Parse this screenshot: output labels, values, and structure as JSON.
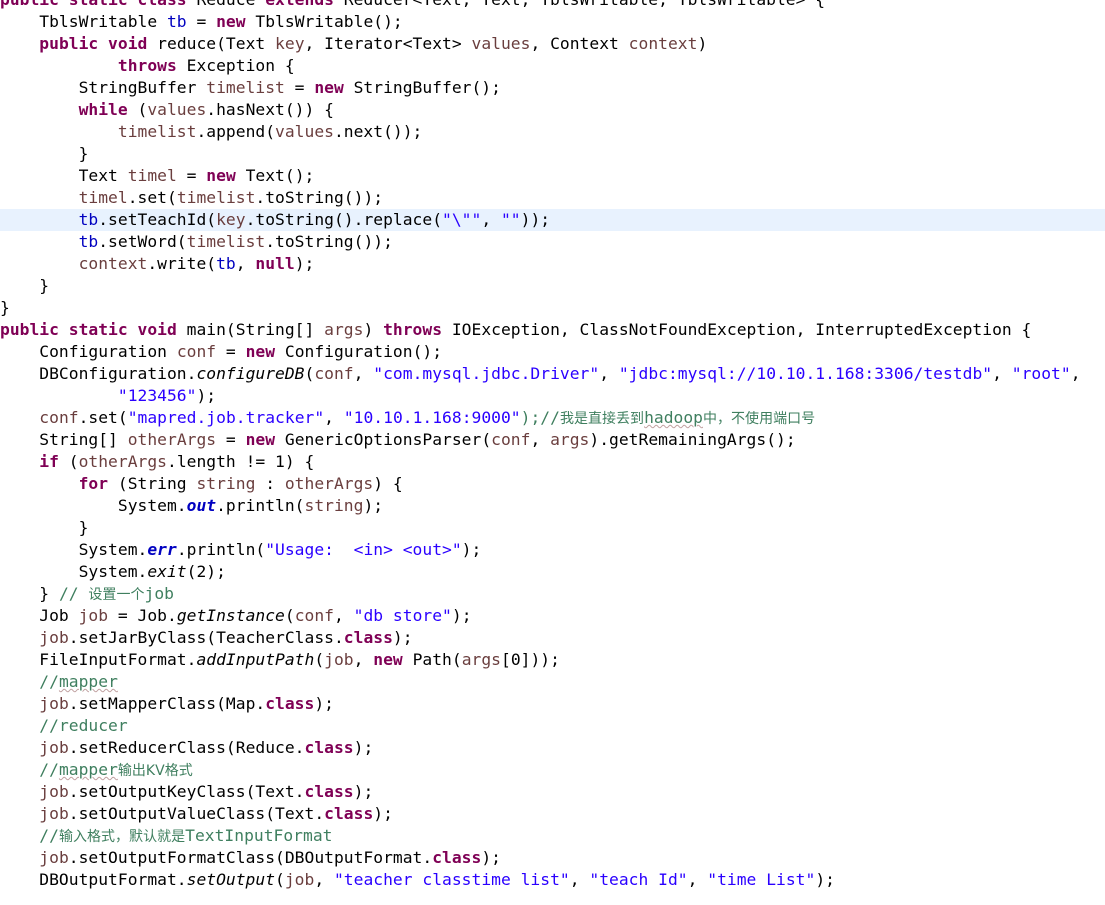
{
  "editor": {
    "lines": [
      {
        "tokens": [
          {
            "t": "public static class ",
            "c": "kw"
          },
          {
            "t": "Reduce "
          },
          {
            "t": "extends ",
            "c": "kw"
          },
          {
            "t": "Reducer<Text, Text, TblsWritable, TblsWritable> {"
          }
        ]
      },
      {
        "tokens": [
          {
            "t": "    TblsWritable "
          },
          {
            "t": "tb",
            "c": "fld"
          },
          {
            "t": " = "
          },
          {
            "t": "new ",
            "c": "kw"
          },
          {
            "t": "TblsWritable();"
          }
        ]
      },
      {
        "tokens": [
          {
            "t": "    "
          },
          {
            "t": "public void ",
            "c": "kw"
          },
          {
            "t": "reduce(Text "
          },
          {
            "t": "key",
            "c": "var"
          },
          {
            "t": ", Iterator<Text> "
          },
          {
            "t": "values",
            "c": "var"
          },
          {
            "t": ", Context "
          },
          {
            "t": "context",
            "c": "var"
          },
          {
            "t": ")"
          }
        ]
      },
      {
        "tokens": [
          {
            "t": "            "
          },
          {
            "t": "throws ",
            "c": "kw"
          },
          {
            "t": "Exception {"
          }
        ]
      },
      {
        "tokens": [
          {
            "t": "        StringBuffer "
          },
          {
            "t": "timelist",
            "c": "var"
          },
          {
            "t": " = "
          },
          {
            "t": "new ",
            "c": "kw"
          },
          {
            "t": "StringBuffer();"
          }
        ]
      },
      {
        "tokens": [
          {
            "t": "        "
          },
          {
            "t": "while ",
            "c": "kw"
          },
          {
            "t": "("
          },
          {
            "t": "values",
            "c": "var"
          },
          {
            "t": ".hasNext()) {"
          }
        ]
      },
      {
        "tokens": [
          {
            "t": "            "
          },
          {
            "t": "timelist",
            "c": "var"
          },
          {
            "t": ".append("
          },
          {
            "t": "values",
            "c": "var"
          },
          {
            "t": ".next());"
          }
        ]
      },
      {
        "tokens": [
          {
            "t": "        }"
          }
        ]
      },
      {
        "tokens": [
          {
            "t": "        Text "
          },
          {
            "t": "timel",
            "c": "var"
          },
          {
            "t": " = "
          },
          {
            "t": "new ",
            "c": "kw"
          },
          {
            "t": "Text();"
          }
        ]
      },
      {
        "tokens": [
          {
            "t": "        "
          },
          {
            "t": "timel",
            "c": "var"
          },
          {
            "t": ".set("
          },
          {
            "t": "timelist",
            "c": "var"
          },
          {
            "t": ".toString());"
          }
        ]
      },
      {
        "hl": true,
        "tokens": [
          {
            "t": "        "
          },
          {
            "t": "tb",
            "c": "fld"
          },
          {
            "t": ".setTeachId("
          },
          {
            "t": "key",
            "c": "var"
          },
          {
            "t": ".toString().replace("
          },
          {
            "t": "\"\\\"\"",
            "c": "str"
          },
          {
            "t": ", "
          },
          {
            "t": "\"\"",
            "c": "str"
          },
          {
            "t": "));"
          }
        ]
      },
      {
        "tokens": [
          {
            "t": "        "
          },
          {
            "t": "tb",
            "c": "fld"
          },
          {
            "t": ".setWord("
          },
          {
            "t": "timelist",
            "c": "var"
          },
          {
            "t": ".toString());"
          }
        ]
      },
      {
        "tokens": [
          {
            "t": "        "
          },
          {
            "t": "context",
            "c": "var"
          },
          {
            "t": ".write("
          },
          {
            "t": "tb",
            "c": "fld"
          },
          {
            "t": ", "
          },
          {
            "t": "null",
            "c": "kw"
          },
          {
            "t": ");"
          }
        ]
      },
      {
        "tokens": [
          {
            "t": "    }"
          }
        ]
      },
      {
        "tokens": [
          {
            "t": "}"
          }
        ]
      },
      {
        "tokens": [
          {
            "t": "public static void ",
            "c": "kw"
          },
          {
            "t": "main(String[] "
          },
          {
            "t": "args",
            "c": "var"
          },
          {
            "t": ") "
          },
          {
            "t": "throws ",
            "c": "kw"
          },
          {
            "t": "IOException, ClassNotFoundException, InterruptedException {"
          }
        ]
      },
      {
        "tokens": [
          {
            "t": "    Configuration "
          },
          {
            "t": "conf",
            "c": "var"
          },
          {
            "t": " = "
          },
          {
            "t": "new ",
            "c": "kw"
          },
          {
            "t": "Configuration();"
          }
        ]
      },
      {
        "tokens": [
          {
            "t": "    DBConfiguration."
          },
          {
            "t": "configureDB",
            "c": "it"
          },
          {
            "t": "("
          },
          {
            "t": "conf",
            "c": "var"
          },
          {
            "t": ", "
          },
          {
            "t": "\"com.mysql.jdbc.Driver\"",
            "c": "str"
          },
          {
            "t": ", "
          },
          {
            "t": "\"jdbc:mysql://10.10.1.168:3306/testdb\"",
            "c": "str"
          },
          {
            "t": ", "
          },
          {
            "t": "\"root\"",
            "c": "str"
          },
          {
            "t": ","
          }
        ]
      },
      {
        "tokens": [
          {
            "t": "            "
          },
          {
            "t": "\"123456\"",
            "c": "str"
          },
          {
            "t": ");"
          }
        ]
      },
      {
        "tokens": [
          {
            "t": "    "
          },
          {
            "t": "conf",
            "c": "var"
          },
          {
            "t": ".set("
          },
          {
            "t": "\"mapred.job.tracker\"",
            "c": "str"
          },
          {
            "t": ", "
          },
          {
            "t": "\"10.10.1.168:9000\"",
            "c": "str"
          },
          {
            "t": ");//",
            "c": "cm"
          },
          {
            "t": "我是直接丢到",
            "c": "cm cjk"
          },
          {
            "t": "hadoop",
            "c": "cm sp"
          },
          {
            "t": "中，不使用端口号",
            "c": "cm cjk"
          }
        ]
      },
      {
        "tokens": [
          {
            "t": "    String[] "
          },
          {
            "t": "otherArgs",
            "c": "var"
          },
          {
            "t": " = "
          },
          {
            "t": "new ",
            "c": "kw"
          },
          {
            "t": "GenericOptionsParser("
          },
          {
            "t": "conf",
            "c": "var"
          },
          {
            "t": ", "
          },
          {
            "t": "args",
            "c": "var"
          },
          {
            "t": ").getRemainingArgs();"
          }
        ]
      },
      {
        "tokens": [
          {
            "t": "    "
          },
          {
            "t": "if ",
            "c": "kw"
          },
          {
            "t": "("
          },
          {
            "t": "otherArgs",
            "c": "var"
          },
          {
            "t": ".length != 1) {"
          }
        ]
      },
      {
        "tokens": [
          {
            "t": "        "
          },
          {
            "t": "for ",
            "c": "kw"
          },
          {
            "t": "(String "
          },
          {
            "t": "string",
            "c": "var"
          },
          {
            "t": " : "
          },
          {
            "t": "otherArgs",
            "c": "var"
          },
          {
            "t": ") {"
          }
        ]
      },
      {
        "tokens": [
          {
            "t": "            System."
          },
          {
            "t": "out",
            "c": "sfld"
          },
          {
            "t": ".println("
          },
          {
            "t": "string",
            "c": "var"
          },
          {
            "t": ");"
          }
        ]
      },
      {
        "tokens": [
          {
            "t": "        }"
          }
        ]
      },
      {
        "tokens": [
          {
            "t": "        System."
          },
          {
            "t": "err",
            "c": "sfld"
          },
          {
            "t": ".println("
          },
          {
            "t": "\"Usage:  <in> <out>\"",
            "c": "str"
          },
          {
            "t": ");"
          }
        ]
      },
      {
        "tokens": [
          {
            "t": "        System."
          },
          {
            "t": "exit",
            "c": "it"
          },
          {
            "t": "(2);"
          }
        ]
      },
      {
        "tokens": [
          {
            "t": "    } "
          },
          {
            "t": "// ",
            "c": "cm"
          },
          {
            "t": "设置一个",
            "c": "cm cjk"
          },
          {
            "t": "job",
            "c": "cm"
          }
        ]
      },
      {
        "tokens": [
          {
            "t": "    Job "
          },
          {
            "t": "job",
            "c": "var"
          },
          {
            "t": " = Job."
          },
          {
            "t": "getInstance",
            "c": "it"
          },
          {
            "t": "("
          },
          {
            "t": "conf",
            "c": "var"
          },
          {
            "t": ", "
          },
          {
            "t": "\"db store\"",
            "c": "str"
          },
          {
            "t": ");"
          }
        ]
      },
      {
        "tokens": [
          {
            "t": "    "
          },
          {
            "t": "job",
            "c": "var"
          },
          {
            "t": ".setJarByClass(TeacherClass."
          },
          {
            "t": "class",
            "c": "kw"
          },
          {
            "t": ");"
          }
        ]
      },
      {
        "tokens": [
          {
            "t": "    FileInputFormat."
          },
          {
            "t": "addInputPath",
            "c": "it"
          },
          {
            "t": "("
          },
          {
            "t": "job",
            "c": "var"
          },
          {
            "t": ", "
          },
          {
            "t": "new ",
            "c": "kw"
          },
          {
            "t": "Path("
          },
          {
            "t": "args",
            "c": "var"
          },
          {
            "t": "[0]));"
          }
        ]
      },
      {
        "tokens": [
          {
            "t": "    "
          },
          {
            "t": "//",
            "c": "cm"
          },
          {
            "t": "mapper",
            "c": "cm sp"
          }
        ]
      },
      {
        "tokens": [
          {
            "t": "    "
          },
          {
            "t": "job",
            "c": "var"
          },
          {
            "t": ".setMapperClass(Map."
          },
          {
            "t": "class",
            "c": "kw"
          },
          {
            "t": ");"
          }
        ]
      },
      {
        "tokens": [
          {
            "t": "    "
          },
          {
            "t": "//reducer",
            "c": "cm"
          }
        ]
      },
      {
        "tokens": [
          {
            "t": "    "
          },
          {
            "t": "job",
            "c": "var"
          },
          {
            "t": ".setReducerClass(Reduce."
          },
          {
            "t": "class",
            "c": "kw"
          },
          {
            "t": ");"
          }
        ]
      },
      {
        "tokens": [
          {
            "t": "    "
          },
          {
            "t": "//",
            "c": "cm"
          },
          {
            "t": "mapper",
            "c": "cm sp"
          },
          {
            "t": "输出KV格式",
            "c": "cm cjk"
          }
        ]
      },
      {
        "tokens": [
          {
            "t": "    "
          },
          {
            "t": "job",
            "c": "var"
          },
          {
            "t": ".setOutputKeyClass(Text."
          },
          {
            "t": "class",
            "c": "kw"
          },
          {
            "t": ");"
          }
        ]
      },
      {
        "tokens": [
          {
            "t": "    "
          },
          {
            "t": "job",
            "c": "var"
          },
          {
            "t": ".setOutputValueClass(Text."
          },
          {
            "t": "class",
            "c": "kw"
          },
          {
            "t": ");"
          }
        ]
      },
      {
        "tokens": [
          {
            "t": "    "
          },
          {
            "t": "//",
            "c": "cm"
          },
          {
            "t": "输入格式，默认就是",
            "c": "cm cjk"
          },
          {
            "t": "TextInputFormat",
            "c": "cm"
          }
        ]
      },
      {
        "tokens": [
          {
            "t": "    "
          },
          {
            "t": "job",
            "c": "var"
          },
          {
            "t": ".setOutputFormatClass(DBOutputFormat."
          },
          {
            "t": "class",
            "c": "kw"
          },
          {
            "t": ");"
          }
        ]
      },
      {
        "tokens": [
          {
            "t": "    DBOutputFormat."
          },
          {
            "t": "setOutput",
            "c": "it"
          },
          {
            "t": "("
          },
          {
            "t": "job",
            "c": "var"
          },
          {
            "t": ", "
          },
          {
            "t": "\"teacher classtime list\"",
            "c": "str"
          },
          {
            "t": ", "
          },
          {
            "t": "\"teach Id\"",
            "c": "str"
          },
          {
            "t": ", "
          },
          {
            "t": "\"time List\"",
            "c": "str"
          },
          {
            "t": ");"
          }
        ]
      }
    ]
  }
}
